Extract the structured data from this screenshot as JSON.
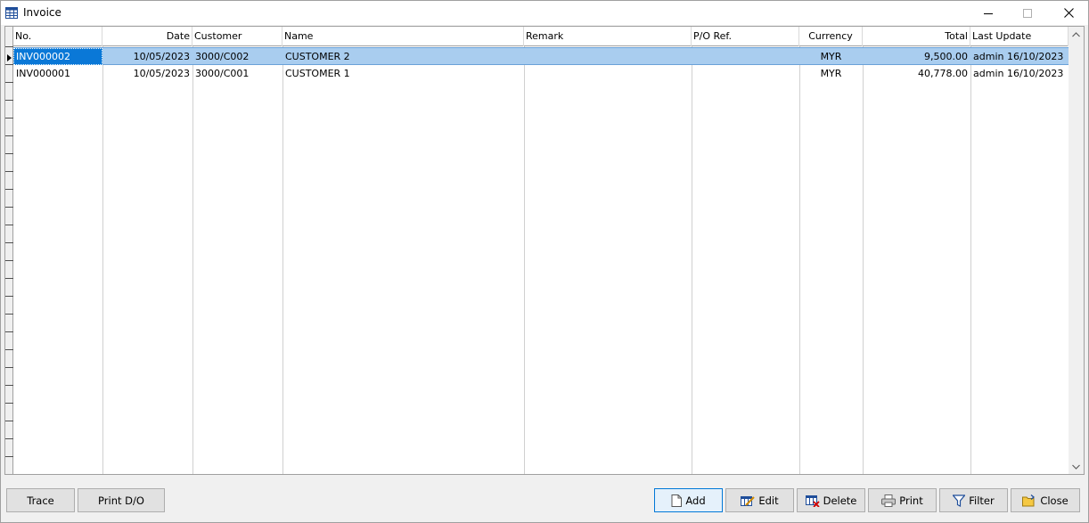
{
  "window": {
    "title": "Invoice"
  },
  "grid": {
    "columns": [
      {
        "key": "no",
        "label": "No."
      },
      {
        "key": "date",
        "label": "Date"
      },
      {
        "key": "customer",
        "label": "Customer"
      },
      {
        "key": "name",
        "label": "Name"
      },
      {
        "key": "remark",
        "label": "Remark"
      },
      {
        "key": "po_ref",
        "label": "P/O Ref."
      },
      {
        "key": "currency",
        "label": "Currency"
      },
      {
        "key": "total",
        "label": "Total"
      },
      {
        "key": "last_update",
        "label": "Last Update"
      }
    ],
    "rows": [
      {
        "no": "INV000002",
        "date": "10/05/2023",
        "customer": "3000/C002",
        "name": "CUSTOMER 2",
        "remark": "",
        "po_ref": "",
        "currency": "MYR",
        "total": "9,500.00",
        "last_update": "admin 16/10/2023"
      },
      {
        "no": "INV000001",
        "date": "10/05/2023",
        "customer": "3000/C001",
        "name": "CUSTOMER 1",
        "remark": "",
        "po_ref": "",
        "currency": "MYR",
        "total": "40,778.00",
        "last_update": "admin 16/10/2023"
      }
    ]
  },
  "buttons": {
    "trace": "Trace",
    "print_do": "Print D/O",
    "add": "Add",
    "edit": "Edit",
    "delete": "Delete",
    "print": "Print",
    "filter": "Filter",
    "close": "Close"
  },
  "icons": {
    "app": "table-icon",
    "add": "new-document-icon",
    "edit": "edit-table-icon",
    "delete": "delete-table-icon",
    "print": "printer-icon",
    "filter": "funnel-icon",
    "close": "open-folder-icon"
  },
  "colors": {
    "selection": "#a9cdef",
    "focus_cell": "#0a78d7",
    "default_button_border": "#0078d7"
  }
}
